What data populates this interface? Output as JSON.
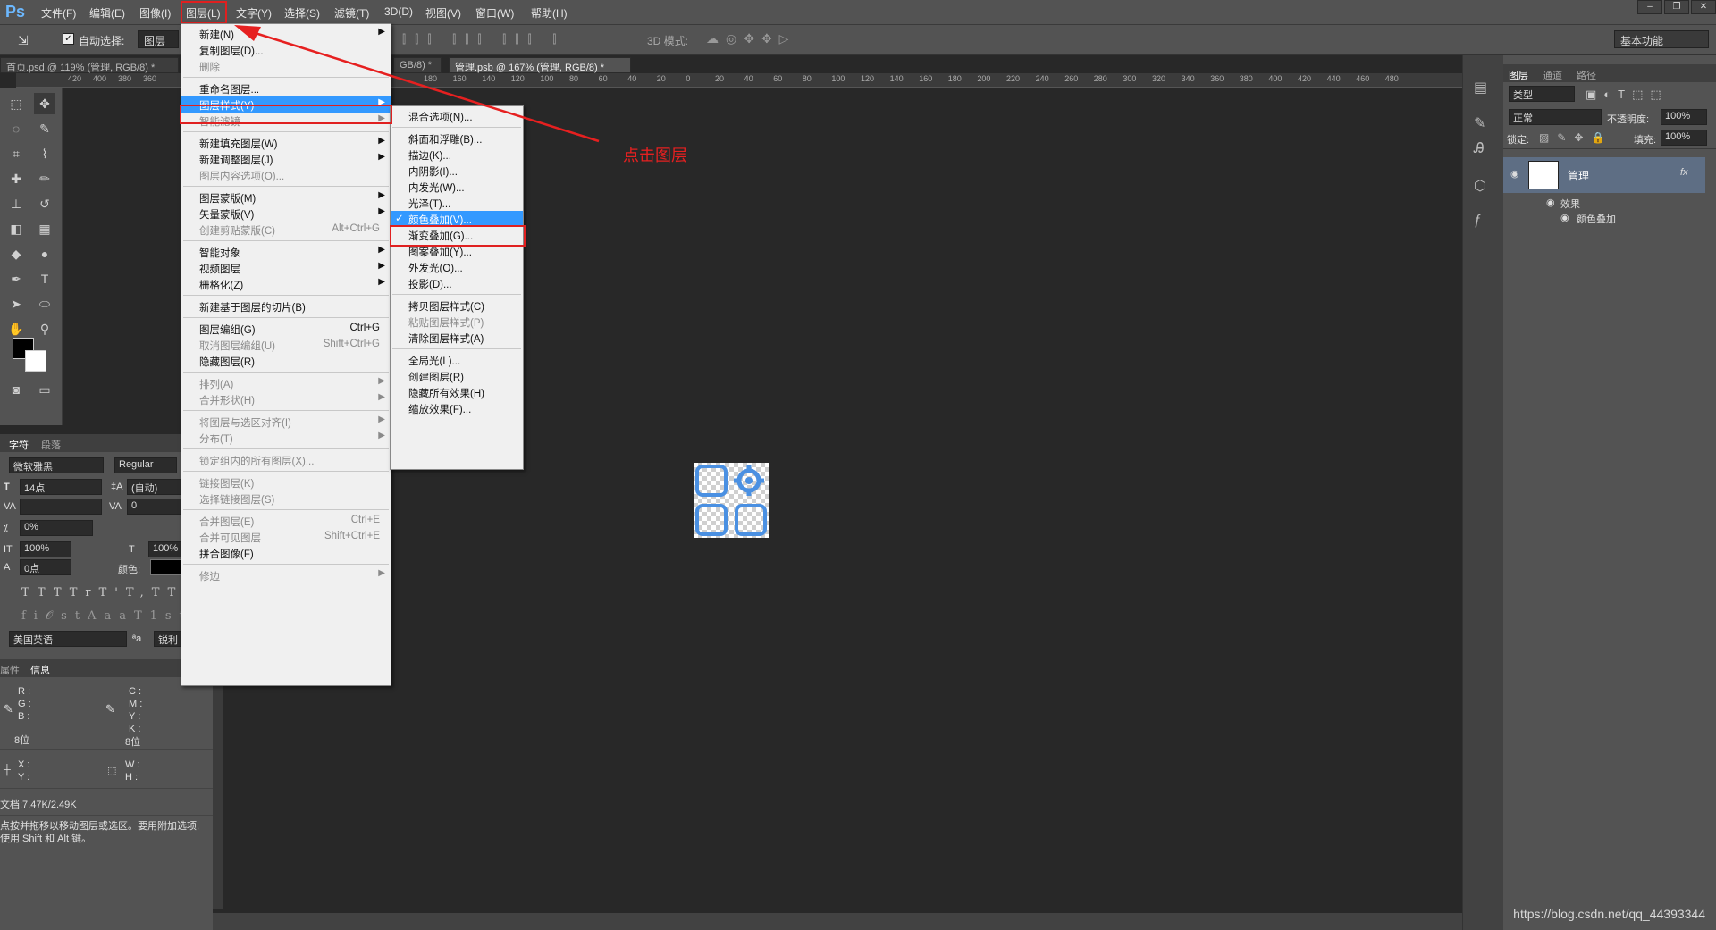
{
  "app": {
    "logo": "Ps"
  },
  "menubar": {
    "items": [
      "文件(F)",
      "编辑(E)",
      "图像(I)",
      "图层(L)",
      "文字(Y)",
      "选择(S)",
      "滤镜(T)",
      "3D(D)",
      "视图(V)",
      "窗口(W)",
      "帮助(H)"
    ],
    "window_controls": [
      "–",
      "❐",
      "✕"
    ]
  },
  "options_bar": {
    "auto_select_label": "自动选择:",
    "auto_select_checked": true,
    "auto_select_target": "图层",
    "mode3d_label": "3D 模式:",
    "workspace": "基本功能"
  },
  "doc_tabs": [
    {
      "label": "首页.psd @ 119% (管理, RGB/8) *",
      "active": false
    },
    {
      "label": "GB/8) *",
      "active": false
    },
    {
      "label": "管理.psb @ 167% (管理, RGB/8) *",
      "active": true
    }
  ],
  "ruler": {
    "labels_left": [
      "420",
      "400",
      "380",
      "360"
    ],
    "labels_right": [
      "180",
      "160",
      "140",
      "120",
      "100",
      "80",
      "60",
      "40",
      "20",
      "0",
      "20",
      "40",
      "60",
      "80",
      "100",
      "120",
      "140",
      "160",
      "180",
      "200",
      "220",
      "240",
      "260",
      "280",
      "300",
      "320",
      "340",
      "360",
      "380",
      "400",
      "420",
      "440",
      "460",
      "480"
    ]
  },
  "character_panel": {
    "tabs": [
      "字符",
      "段落"
    ],
    "font_family": "微软雅黑",
    "font_style": "Regular",
    "font_size": "14点",
    "leading": "(自动)",
    "kerning": "",
    "tracking": "0",
    "scale_percent": "0%",
    "vertical_scale": "100%",
    "horizontal_scale": "100%",
    "baseline_shift": "0点",
    "color_label": "颜色:",
    "language": "美国英语",
    "aa_label": "ªa",
    "antialias": "锐利"
  },
  "info_panel": {
    "tabs": [
      "属性",
      "信息"
    ],
    "rgb_labels": [
      "R :",
      "G :",
      "B :"
    ],
    "cmyk_labels": [
      "C :",
      "M :",
      "Y :",
      "K :"
    ],
    "bit_left": "8位",
    "bit_right": "8位",
    "xy_labels": [
      "X :",
      "Y :"
    ],
    "wh_labels": [
      "W :",
      "H :"
    ],
    "doc_size": "文档:7.47K/2.49K",
    "hint": "点按并拖移以移动图层或选区。要用附加选项,使用 Shift 和 Alt 键。"
  },
  "layer_menu": {
    "items": [
      {
        "label": "新建(N)",
        "arrow": true
      },
      {
        "label": "复制图层(D)..."
      },
      {
        "label": "删除",
        "disabled": true
      },
      {
        "sep": true
      },
      {
        "label": "重命名图层..."
      },
      {
        "label": "图层样式(Y)",
        "arrow": true,
        "highlight": true
      },
      {
        "label": "智能滤镜",
        "arrow": true,
        "disabled": true
      },
      {
        "sep": true
      },
      {
        "label": "新建填充图层(W)",
        "arrow": true
      },
      {
        "label": "新建调整图层(J)",
        "arrow": true
      },
      {
        "label": "图层内容选项(O)...",
        "disabled": true
      },
      {
        "sep": true
      },
      {
        "label": "图层蒙版(M)",
        "arrow": true
      },
      {
        "label": "矢量蒙版(V)",
        "arrow": true
      },
      {
        "label": "创建剪贴蒙版(C)",
        "shortcut": "Alt+Ctrl+G",
        "disabled": true
      },
      {
        "sep": true
      },
      {
        "label": "智能对象",
        "arrow": true
      },
      {
        "label": "视频图层",
        "arrow": true
      },
      {
        "label": "栅格化(Z)",
        "arrow": true
      },
      {
        "sep": true
      },
      {
        "label": "新建基于图层的切片(B)"
      },
      {
        "sep": true
      },
      {
        "label": "图层编组(G)",
        "shortcut": "Ctrl+G"
      },
      {
        "label": "取消图层编组(U)",
        "shortcut": "Shift+Ctrl+G",
        "disabled": true
      },
      {
        "label": "隐藏图层(R)"
      },
      {
        "sep": true
      },
      {
        "label": "排列(A)",
        "arrow": true,
        "disabled": true
      },
      {
        "label": "合并形状(H)",
        "arrow": true,
        "disabled": true
      },
      {
        "sep": true
      },
      {
        "label": "将图层与选区对齐(I)",
        "arrow": true,
        "disabled": true
      },
      {
        "label": "分布(T)",
        "arrow": true,
        "disabled": true
      },
      {
        "sep": true
      },
      {
        "label": "锁定组内的所有图层(X)...",
        "disabled": true
      },
      {
        "sep": true
      },
      {
        "label": "链接图层(K)",
        "disabled": true
      },
      {
        "label": "选择链接图层(S)",
        "disabled": true
      },
      {
        "sep": true
      },
      {
        "label": "合并图层(E)",
        "shortcut": "Ctrl+E",
        "disabled": true
      },
      {
        "label": "合并可见图层",
        "shortcut": "Shift+Ctrl+E",
        "disabled": true
      },
      {
        "label": "拼合图像(F)"
      },
      {
        "sep": true
      },
      {
        "label": "修边",
        "arrow": true,
        "disabled": true
      }
    ]
  },
  "style_submenu": {
    "items": [
      {
        "label": "混合选项(N)..."
      },
      {
        "sep": true
      },
      {
        "label": "斜面和浮雕(B)..."
      },
      {
        "label": "描边(K)..."
      },
      {
        "label": "内阴影(I)..."
      },
      {
        "label": "内发光(W)..."
      },
      {
        "label": "光泽(T)..."
      },
      {
        "label": "颜色叠加(V)...",
        "checked": true,
        "highlight": true
      },
      {
        "label": "渐变叠加(G)..."
      },
      {
        "label": "图案叠加(Y)..."
      },
      {
        "label": "外发光(O)..."
      },
      {
        "label": "投影(D)..."
      },
      {
        "sep": true
      },
      {
        "label": "拷贝图层样式(C)"
      },
      {
        "label": "粘贴图层样式(P)",
        "disabled": true
      },
      {
        "label": "清除图层样式(A)"
      },
      {
        "sep": true
      },
      {
        "label": "全局光(L)..."
      },
      {
        "label": "创建图层(R)"
      },
      {
        "label": "隐藏所有效果(H)"
      },
      {
        "label": "缩放效果(F)..."
      }
    ]
  },
  "annotation": {
    "text": "点击图层",
    "color": "#e62020"
  },
  "layers_panel": {
    "tabs": [
      "图层",
      "通道",
      "路径"
    ],
    "filter": "类型",
    "blend_mode": "正常",
    "opacity_label": "不透明度:",
    "opacity": "100%",
    "lock_label": "锁定:",
    "fill_label": "填充:",
    "fill": "100%",
    "layer_name": "管理",
    "fx_label": "fx",
    "effects_label": "效果",
    "effect_item": "颜色叠加"
  },
  "watermark": "https://blog.csdn.net/qq_44393344",
  "colors": {
    "accent": "#3399ff",
    "annotation_red": "#e62020",
    "icon_blue": "#4a90e2"
  }
}
